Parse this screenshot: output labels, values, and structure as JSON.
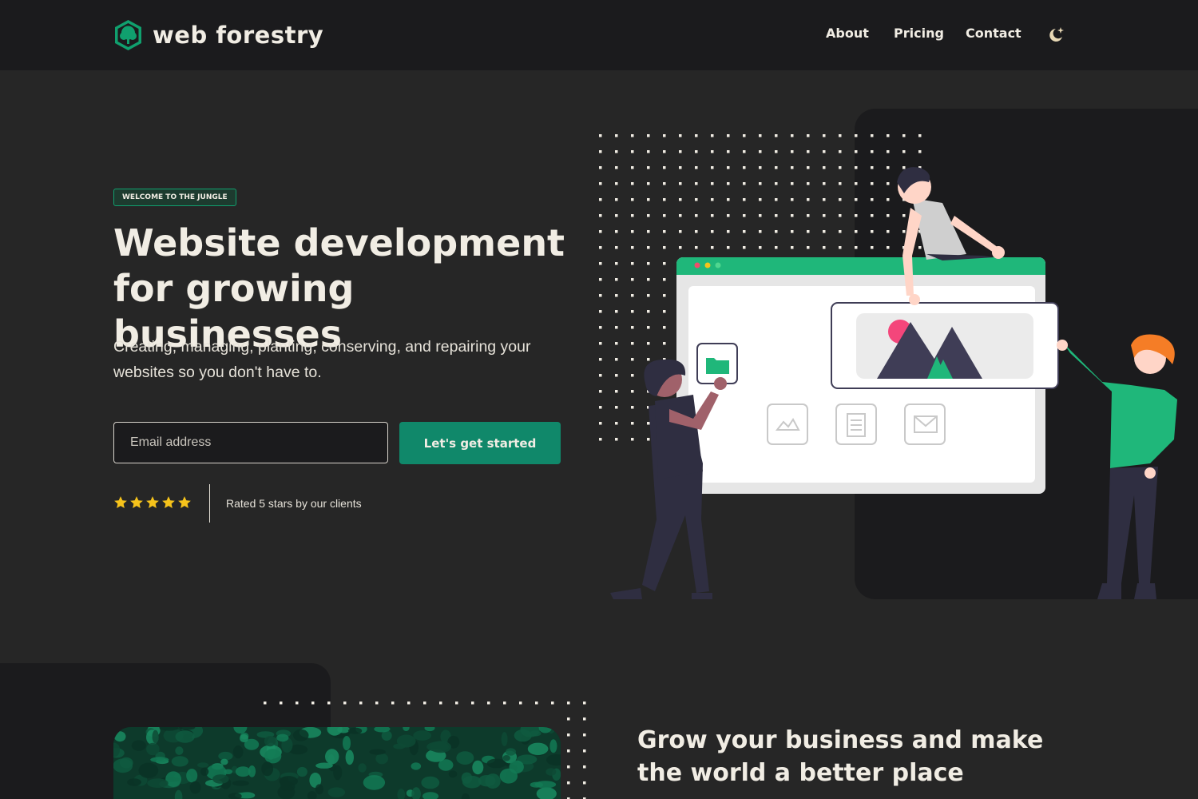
{
  "brand": {
    "name": "web forestry",
    "accent": "#10a06e"
  },
  "nav": {
    "items": [
      "About",
      "Pricing",
      "Contact"
    ],
    "theme_toggle_icon": "moon-stars-icon"
  },
  "hero": {
    "badge": "WELCOME TO THE JUNGLE",
    "title": "Website development for growing businesses",
    "subtitle": "Creating, managing, planting, conserving, and repairing your websites so you don't have to.",
    "email_placeholder": "Email address",
    "email_value": "",
    "cta_label": "Let's get started",
    "rating": {
      "stars": 5,
      "max": 5,
      "text": "Rated 5 stars by our clients"
    }
  },
  "section2": {
    "title": "Grow your business and make the world a better place"
  },
  "colors": {
    "background": "#262626",
    "header": "#1b1b1d",
    "cta": "#10886a",
    "star": "#f6c31b",
    "text": "#f1ede4"
  }
}
